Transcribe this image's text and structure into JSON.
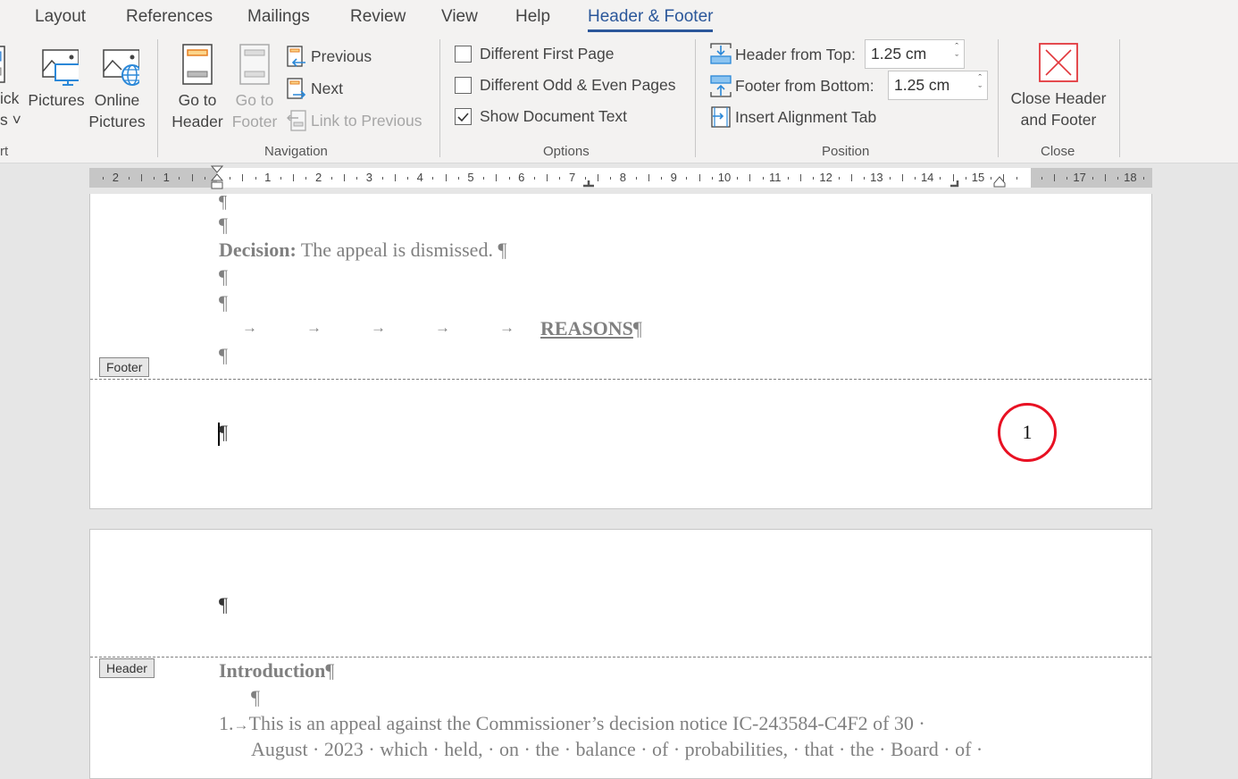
{
  "ribbon": {
    "tabs": [
      {
        "label": "Layout",
        "active": false
      },
      {
        "label": "References",
        "active": false
      },
      {
        "label": "Mailings",
        "active": false
      },
      {
        "label": "Review",
        "active": false
      },
      {
        "label": "View",
        "active": false
      },
      {
        "label": "Help",
        "active": false
      },
      {
        "label": "Header & Footer",
        "active": true
      }
    ],
    "insert_group": {
      "partial_label": "rt",
      "quick_parts_label_line1": "ick",
      "quick_parts_label_line2": "s ˅",
      "pictures_label": "Pictures",
      "online_pictures_line1": "Online",
      "online_pictures_line2": "Pictures"
    },
    "navigation": {
      "label": "Navigation",
      "go_to_header_line1": "Go to",
      "go_to_header_line2": "Header",
      "go_to_footer_line1": "Go to",
      "go_to_footer_line2": "Footer",
      "previous": "Previous",
      "next": "Next",
      "link_to_previous": "Link to Previous"
    },
    "options": {
      "label": "Options",
      "items": [
        {
          "label": "Different First Page",
          "checked": false
        },
        {
          "label": "Different Odd & Even Pages",
          "checked": false
        },
        {
          "label": "Show Document Text",
          "checked": true
        }
      ]
    },
    "position": {
      "label": "Position",
      "header_from_top_label": "Header from Top:",
      "header_from_top_value": "1.25 cm",
      "footer_from_bottom_label": "Footer from Bottom:",
      "footer_from_bottom_value": "1.25 cm",
      "insert_alignment_tab": "Insert Alignment Tab"
    },
    "close": {
      "label": "Close",
      "button_line1": "Close Header",
      "button_line2": "and Footer"
    },
    "accent_color": "#2b579a"
  },
  "ruler": {
    "left_numbers": [
      "2",
      "1"
    ],
    "right_numbers": [
      "1",
      "2",
      "3",
      "4",
      "5",
      "6",
      "7",
      "8",
      "9",
      "10",
      "11",
      "12",
      "13",
      "14",
      "15"
    ],
    "margin_numbers": [
      "17",
      "18"
    ]
  },
  "page1": {
    "lines": {
      "decision_bold": "Decision:",
      "decision_text": " The appeal is dismissed. ",
      "reasons": "REASONS",
      "tab_arrow": "→"
    },
    "footer_tag": "Footer",
    "page_number": "1",
    "page_number_circle_color": "#e81123"
  },
  "page2": {
    "header_tag": "Header",
    "introduction": "Introduction",
    "para1_number": "1.",
    "para1_line1": "This is an appeal against the Commissioner’s decision notice IC-243584-C4F2 of 30 ·",
    "para1_line2": "August · 2023 · which · held, · on · the · balance · of · probabilities, · that · the · Board · of ·"
  },
  "pilcrow": "¶"
}
